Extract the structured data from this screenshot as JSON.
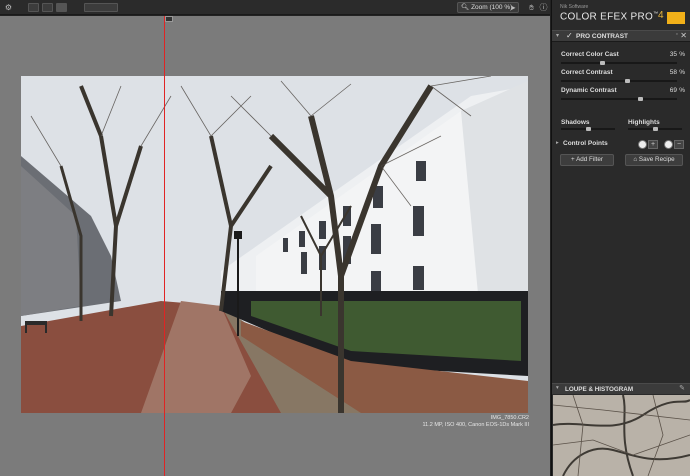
{
  "toolbar": {
    "zoom_label": "Zoom (100 %)",
    "zoom_arrow": "▸"
  },
  "image_info": {
    "filename": "IMG_7850.CR2",
    "details": "11.2 MP, ISO 400, Canon EOS-1Ds Mark III"
  },
  "panel": {
    "vendor": "Nik Software",
    "product": "COLOR EFEX PRO",
    "product_tm": "™",
    "version": "4",
    "filter": {
      "title": "PRO CONTRAST",
      "sliders": [
        {
          "label": "Correct Color Cast",
          "value": "35",
          "unit": "%",
          "fraction": 0.35
        },
        {
          "label": "Correct Contrast",
          "value": "58",
          "unit": "%",
          "fraction": 0.58
        },
        {
          "label": "Dynamic Contrast",
          "value": "69",
          "unit": "%",
          "fraction": 0.69
        }
      ],
      "shadows_label": "Shadows",
      "shadows_fraction": 0.5,
      "highlights_label": "Highlights",
      "highlights_fraction": 0.5,
      "control_points_label": "Control Points"
    },
    "add_filter_label": "+ Add Filter",
    "save_recipe_label": "Save Recipe",
    "loupe_title": "LOUPE & HISTOGRAM"
  },
  "colors": {
    "split_line": "#e02424",
    "accent": "#e8b53a",
    "canvas_bg": "#7b7b7b",
    "panel_bg": "#2a2a2a"
  },
  "icons": {
    "toolbar_left": [
      "settings-icon",
      "single-view-icon",
      "split-view-icon",
      "side-by-side-icon"
    ],
    "toolbar_right": [
      "arrow-down-icon",
      "hand-icon",
      "info-icon"
    ],
    "filter": [
      "chevron-down-icon",
      "check-icon",
      "close-icon"
    ],
    "control_points": [
      "add-point-icon",
      "remove-point-icon"
    ],
    "loupe": [
      "pin-icon"
    ]
  }
}
